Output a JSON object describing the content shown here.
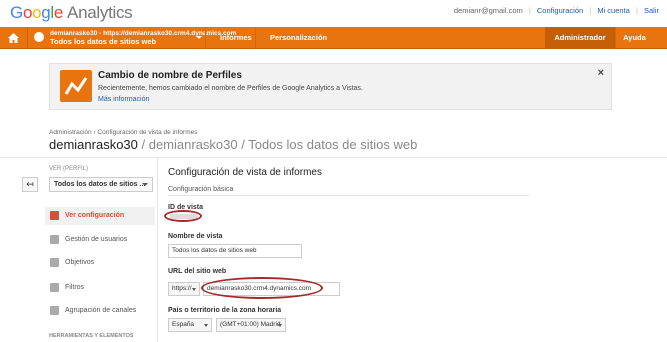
{
  "topbar": {
    "logo_letters": [
      "G",
      "o",
      "o",
      "g",
      "l",
      "e"
    ],
    "logo_product": "Analytics",
    "email": "demianr@gmail.com",
    "links": [
      "Configuración",
      "Mi cuenta",
      "Salir"
    ]
  },
  "navbar": {
    "account_url": "demianrasko30 - https://demianrasko30.crm4.dynamics.com",
    "account_view": "Todos los datos de sitios web",
    "items": [
      "Informes",
      "Personalización",
      "Administrador",
      "Ayuda"
    ],
    "active_item": "Administrador",
    "accent_color": "#e8740f"
  },
  "banner": {
    "title": "Cambio de nombre de Perfiles",
    "text": "Recientemente, hemos cambiado el nombre de Perfiles de Google Analytics a Vistas.",
    "link": "Más información",
    "close": "×"
  },
  "breadcrumb": "Administración › Configuración de vista de informes",
  "page_title": {
    "main": "demianrasko30",
    "sub": " / demianrasko30 / Todos los datos de sitios web"
  },
  "sidebar": {
    "view_label": "VER (PERFIL)",
    "view_value": "Todos los datos de sitios ...",
    "menu": [
      {
        "label": "Ver configuración",
        "icon": "document-icon",
        "active": true
      },
      {
        "label": "Gestión de usuarios",
        "icon": "users-icon",
        "active": false
      },
      {
        "label": "Objetivos",
        "icon": "flag-icon",
        "active": false
      },
      {
        "label": "Filtros",
        "icon": "filter-icon",
        "active": false
      },
      {
        "label": "Agrupación de canales",
        "icon": "channels-icon",
        "active": false
      }
    ],
    "section_label": "HERRAMIENTAS Y ELEMENTOS"
  },
  "content": {
    "title": "Configuración de vista de informes",
    "subtitle": "Configuración básica",
    "view_id_label": "ID de vista",
    "view_name_label": "Nombre de vista",
    "view_name_value": "Todos los datos de sitios web",
    "url_label": "URL del sitio web",
    "url_protocol": "https://",
    "url_value": "demianrasko30.crm4.dynamics.com",
    "tz_label": "País o territorio de la zona horaria",
    "country": "España",
    "timezone": "(GMT+01:00) Madrid"
  },
  "annotation_color": "#a52a2a"
}
